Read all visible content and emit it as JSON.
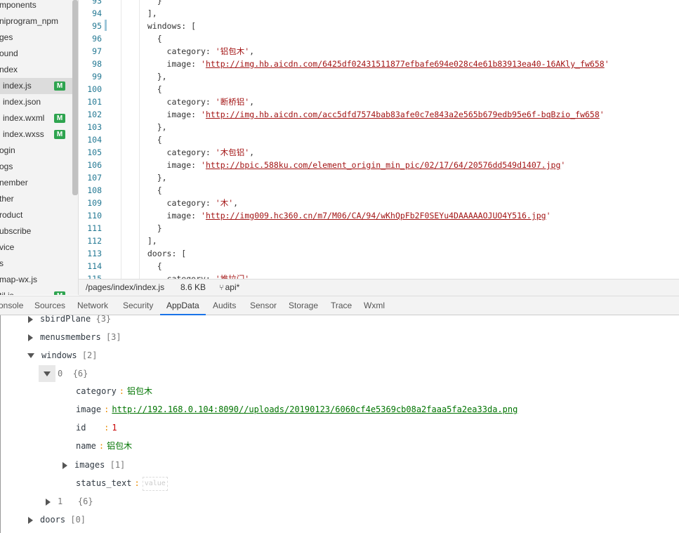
{
  "file_tree": {
    "items": [
      {
        "label": "mponents",
        "badge": ""
      },
      {
        "label": "niprogram_npm",
        "badge": ""
      },
      {
        "label": "ges",
        "badge": ""
      },
      {
        "label": "ound",
        "badge": ""
      },
      {
        "label": "ndex",
        "badge": ""
      },
      {
        "label": "index.js",
        "badge": "M"
      },
      {
        "label": "index.json",
        "badge": ""
      },
      {
        "label": "index.wxml",
        "badge": "M"
      },
      {
        "label": "index.wxss",
        "badge": "M"
      },
      {
        "label": "ogin",
        "badge": ""
      },
      {
        "label": "ogs",
        "badge": ""
      },
      {
        "label": "nember",
        "badge": ""
      },
      {
        "label": "ther",
        "badge": ""
      },
      {
        "label": "roduct",
        "badge": ""
      },
      {
        "label": "ubscribe",
        "badge": ""
      },
      {
        "label": "vice",
        "badge": ""
      },
      {
        "label": "s",
        "badge": ""
      },
      {
        "label": "map-wx.js",
        "badge": ""
      },
      {
        "label": "til.js",
        "badge": "M"
      }
    ]
  },
  "editor": {
    "lines": [
      {
        "n": "93",
        "code": "    }"
      },
      {
        "n": "94",
        "code": "  ],"
      },
      {
        "n": "95",
        "code": "  windows: ["
      },
      {
        "n": "96",
        "code": "    {"
      },
      {
        "n": "97",
        "key": "      category: ",
        "str": "'铝包木'",
        "tail": ","
      },
      {
        "n": "98",
        "key": "      image: ",
        "q1": "'",
        "url": "http://img.hb.aicdn.com/6425df02431511877efbafe694e028c4e61b83913ea40-16AKly_fw658",
        "q2": "'"
      },
      {
        "n": "99",
        "code": "    },"
      },
      {
        "n": "100",
        "code": "    {"
      },
      {
        "n": "101",
        "key": "      category: ",
        "str": "'断桥铝'",
        "tail": ","
      },
      {
        "n": "102",
        "key": "      image: ",
        "q1": "'",
        "url": "http://img.hb.aicdn.com/acc5dfd7574bab83afe0c7e843a2e565b679edb95e6f-bqBzio_fw658",
        "q2": "'"
      },
      {
        "n": "103",
        "code": "    },"
      },
      {
        "n": "104",
        "code": "    {"
      },
      {
        "n": "105",
        "key": "      category: ",
        "str": "'木包铝'",
        "tail": ","
      },
      {
        "n": "106",
        "key": "      image: ",
        "q1": "'",
        "url": "http://bpic.588ku.com/element_origin_min_pic/02/17/64/20576dd549d1407.jpg",
        "q2": "'"
      },
      {
        "n": "107",
        "code": "    },"
      },
      {
        "n": "108",
        "code": "    {"
      },
      {
        "n": "109",
        "key": "      category: ",
        "str": "'木'",
        "tail": ","
      },
      {
        "n": "110",
        "key": "      image: ",
        "q1": "'",
        "url": "http://img009.hc360.cn/m7/M06/CA/94/wKhQpFb2F0SEYu4DAAAAAOJUO4Y516.jpg",
        "q2": "'"
      },
      {
        "n": "111",
        "code": "    }"
      },
      {
        "n": "112",
        "code": "  ],"
      },
      {
        "n": "113",
        "code": "  doors: ["
      },
      {
        "n": "114",
        "code": "    {"
      },
      {
        "n": "115",
        "key": "      category: ",
        "str": "'推拉门'",
        "tail": ""
      }
    ]
  },
  "statusbar": {
    "path": "/pages/index/index.js",
    "size": "8.6 KB",
    "branch": "api*"
  },
  "devtools_tabs": [
    "onsole",
    "Sources",
    "Network",
    "Security",
    "AppData",
    "Audits",
    "Sensor",
    "Storage",
    "Trace",
    "Wxml"
  ],
  "active_tab": "AppData",
  "appdata": {
    "sbirdPlane": {
      "key": "sbirdPlane",
      "count": "{3}"
    },
    "menusmembers": {
      "key": "menusmembers",
      "count": "[3]"
    },
    "windows": {
      "key": "windows",
      "count": "[2]"
    },
    "item0": {
      "key": "0",
      "count": "{6}"
    },
    "category": {
      "key": "category",
      "sep": ":",
      "value": "铝包木"
    },
    "image": {
      "key": "image",
      "sep": ":",
      "value": "http://192.168.0.104:8090//uploads/20190123/6060cf4e5369cb08a2faaa5fa2ea33da.png"
    },
    "id": {
      "key": "id",
      "sep": ":",
      "value": "1"
    },
    "name": {
      "key": "name",
      "sep": ":",
      "value": "铝包木"
    },
    "images": {
      "key": "images",
      "count": "[1]"
    },
    "status_text": {
      "key": "status_text",
      "sep": ":",
      "placeholder": "value"
    },
    "item1": {
      "key": "1",
      "count": "{6}"
    },
    "doors": {
      "key": "doors",
      "count": "[0]"
    }
  }
}
